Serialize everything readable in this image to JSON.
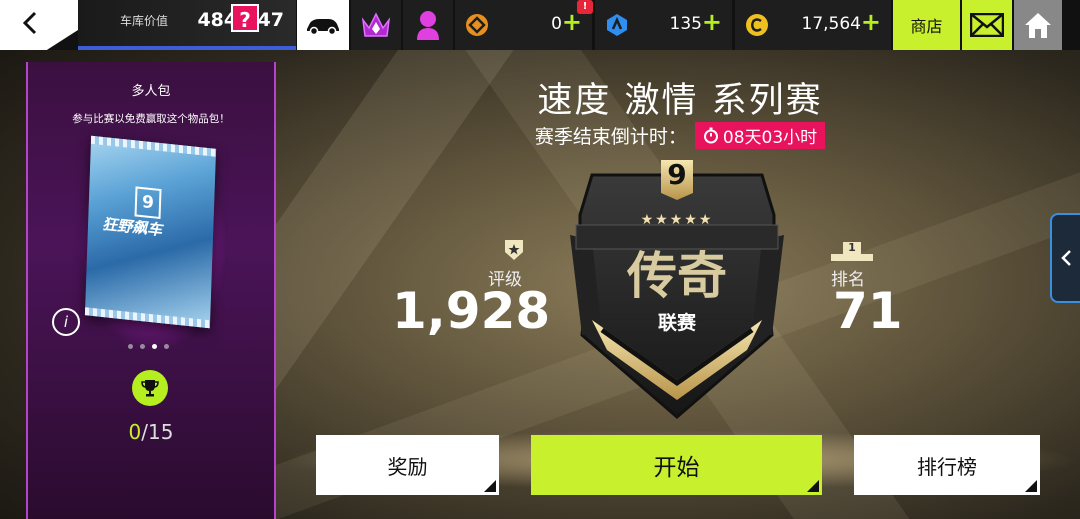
{
  "topbar": {
    "garage_label": "车库价值",
    "garage_value": "484,047",
    "currency_1_value": "0",
    "currency_1_alert": "!",
    "currency_2_value": "135",
    "credits_value": "17,564",
    "plus": "+",
    "shop_label": "商店"
  },
  "pack": {
    "title": "多人包",
    "subtitle": "参与比赛以免费赢取这个物品包！",
    "help": "?",
    "info": "i",
    "pack_logo": "9",
    "pack_name": "狂野飙车",
    "progress_current": "0",
    "progress_total": "/15"
  },
  "event": {
    "title": "速度 激情 系列赛",
    "countdown_label": "赛季结束倒计时：",
    "countdown_value": "08天03小时"
  },
  "league": {
    "number": "9",
    "stars": "★★★★★",
    "name": "传奇",
    "sub": "联赛"
  },
  "stats": {
    "rating_label": "评级",
    "rating_value": "1,928",
    "rank_icon_text": "1",
    "rank_label": "排名",
    "rank_value": "71"
  },
  "buttons": {
    "rewards": "奖励",
    "start": "开始",
    "leaderboard": "排行榜"
  },
  "colors": {
    "accent_green": "#c8f02c",
    "accent_pink": "#e8135c",
    "purple_panel": "#4b1458"
  }
}
